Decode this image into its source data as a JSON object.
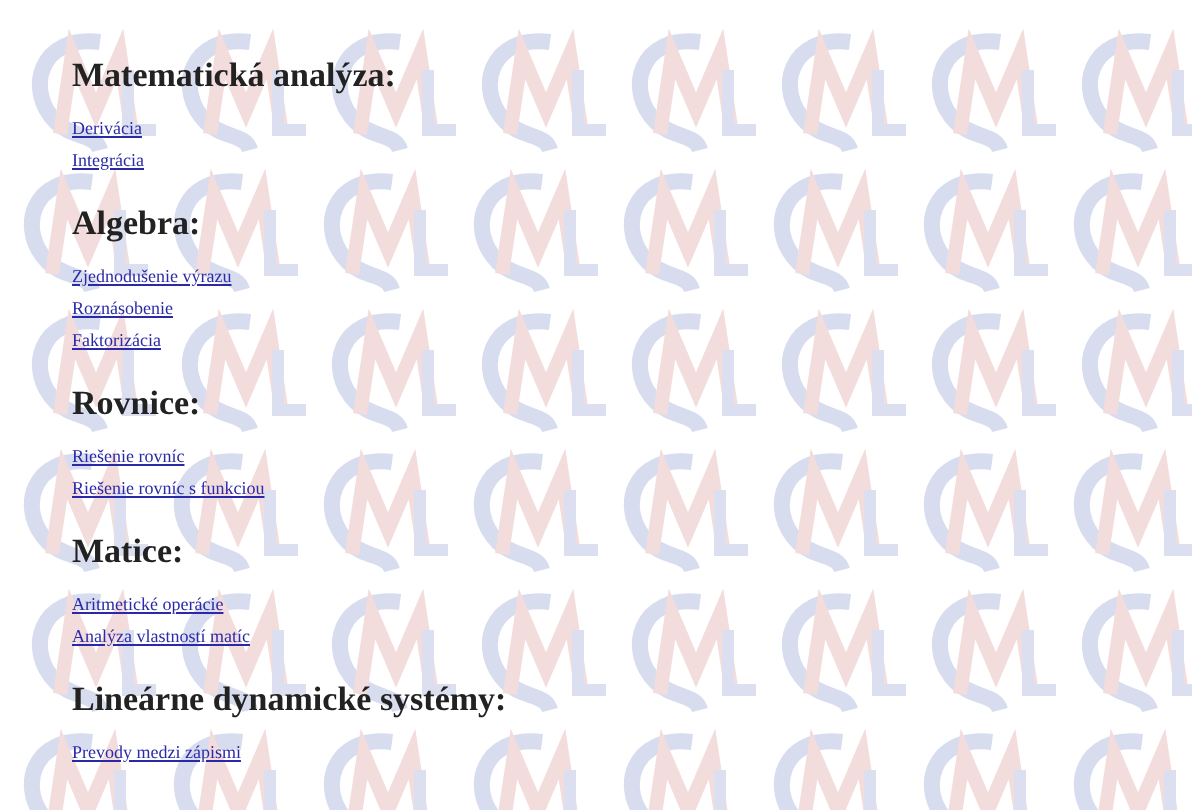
{
  "sections": [
    {
      "heading": "Matematická analýza:",
      "links": [
        "Derivácia",
        "Integrácia"
      ]
    },
    {
      "heading": "Algebra:",
      "links": [
        "Zjednodušenie výrazu",
        "Roznásobenie",
        "Faktorizácia"
      ]
    },
    {
      "heading": "Rovnice:",
      "links": [
        "Riešenie rovníc",
        "Riešenie rovníc s funkciou"
      ]
    },
    {
      "heading": "Matice:",
      "links": [
        "Aritmetické operácie",
        "Analýza vlastností matíc"
      ]
    },
    {
      "heading": "Lineárne dynamické systémy:",
      "links": [
        "Prevody medzi zápismi"
      ]
    }
  ]
}
